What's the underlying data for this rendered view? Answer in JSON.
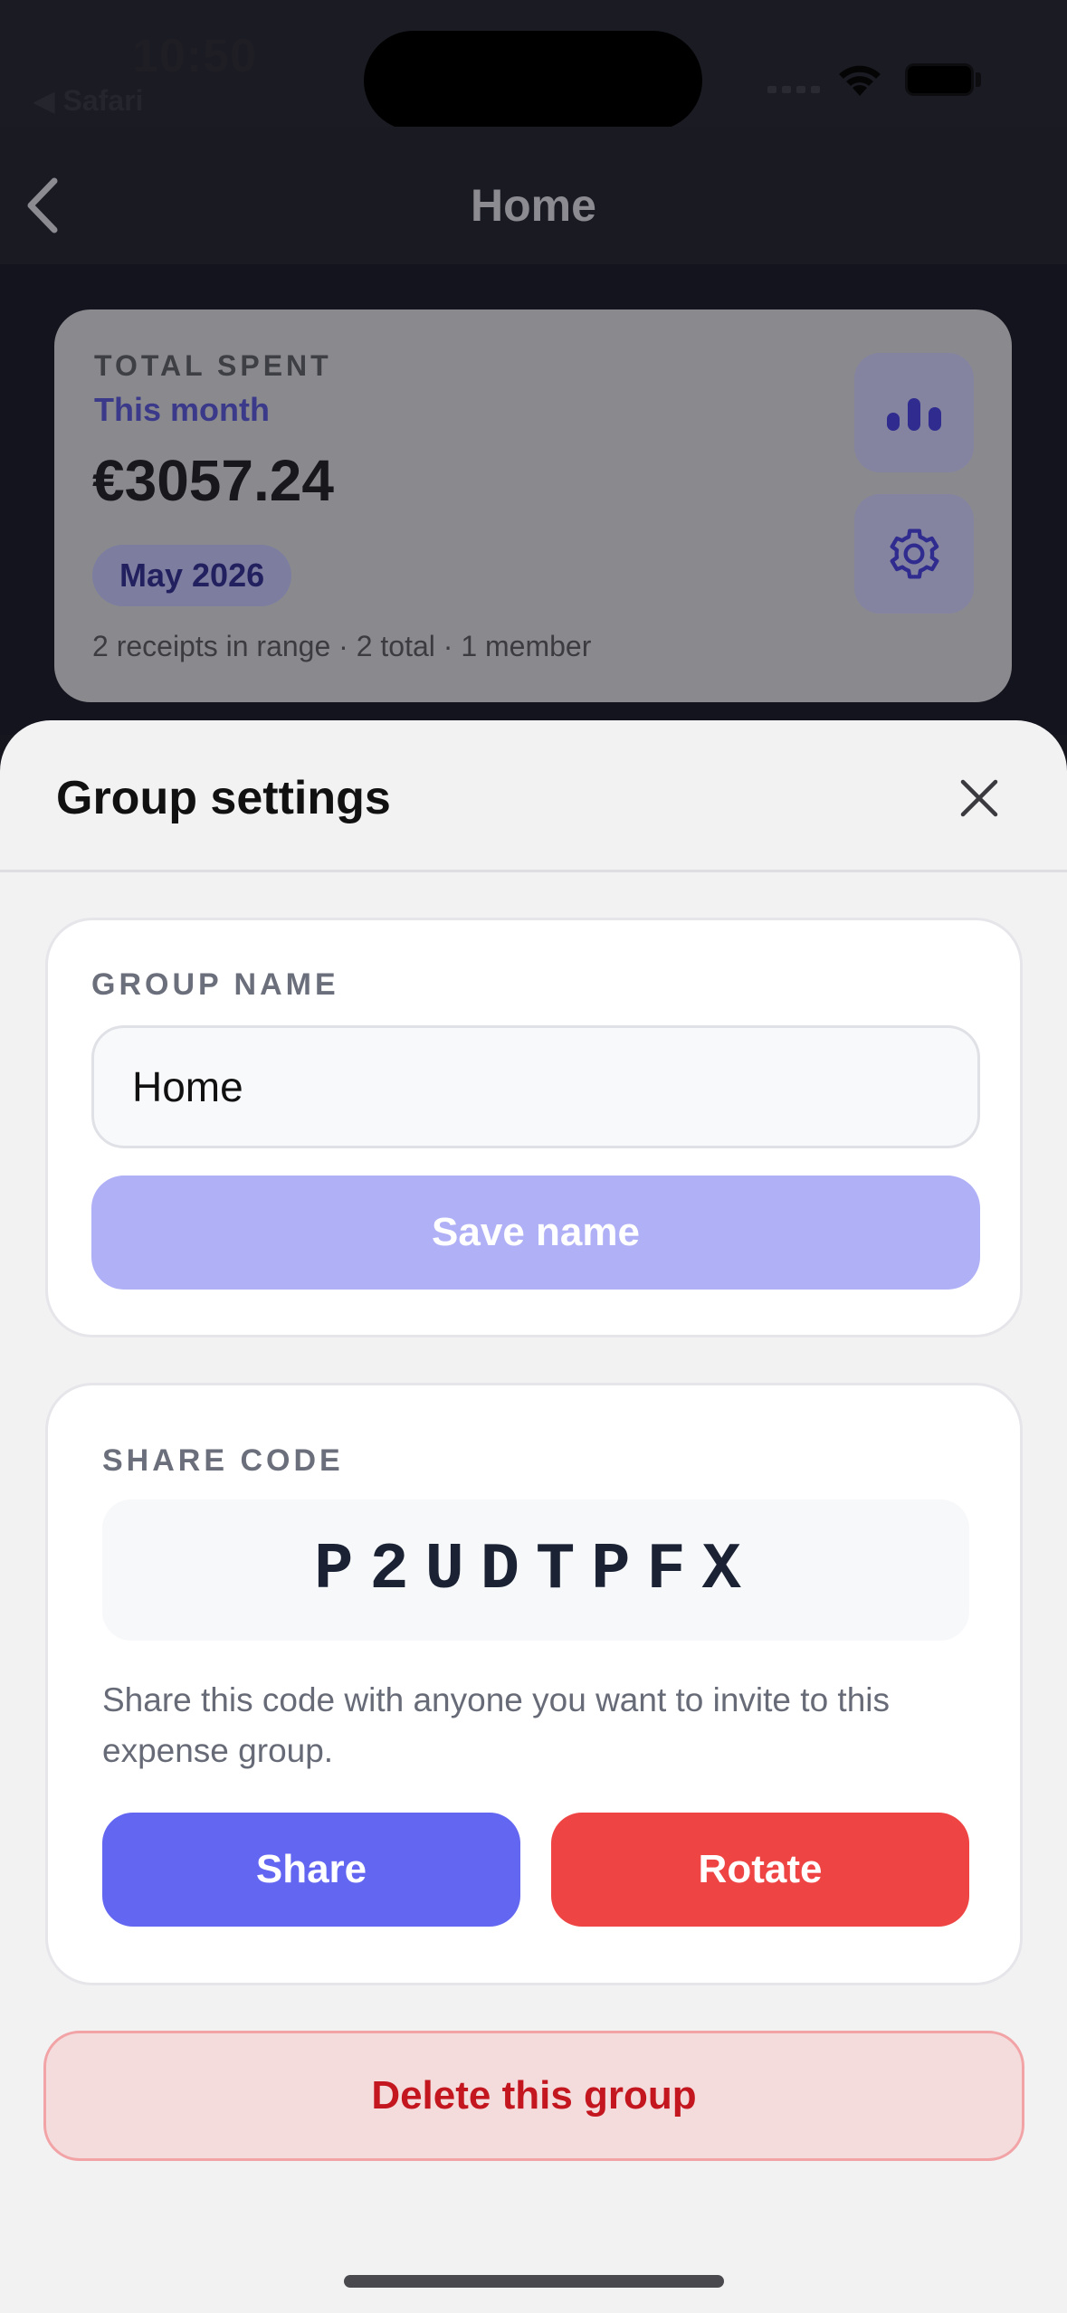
{
  "status_bar": {
    "time": "10:50",
    "back_app": "◀ Safari"
  },
  "nav": {
    "title": "Home"
  },
  "summary": {
    "label": "TOTAL SPENT",
    "range": "This month",
    "amount": "€3057.24",
    "period": "May 2026",
    "meta": "2 receipts in range · 2 total · 1 member"
  },
  "sheet": {
    "title": "Group settings",
    "group_name": {
      "label": "GROUP NAME",
      "value": "Home",
      "save_label": "Save name"
    },
    "share_code": {
      "label": "SHARE CODE",
      "code": "P2UDTPFX",
      "description": "Share this code with anyone you want to invite to this expense group.",
      "share_label": "Share",
      "rotate_label": "Rotate"
    },
    "delete_label": "Delete this group"
  },
  "colors": {
    "accent": "#6366f1",
    "danger": "#ef4444",
    "save_disabled": "#b0b0f7"
  }
}
